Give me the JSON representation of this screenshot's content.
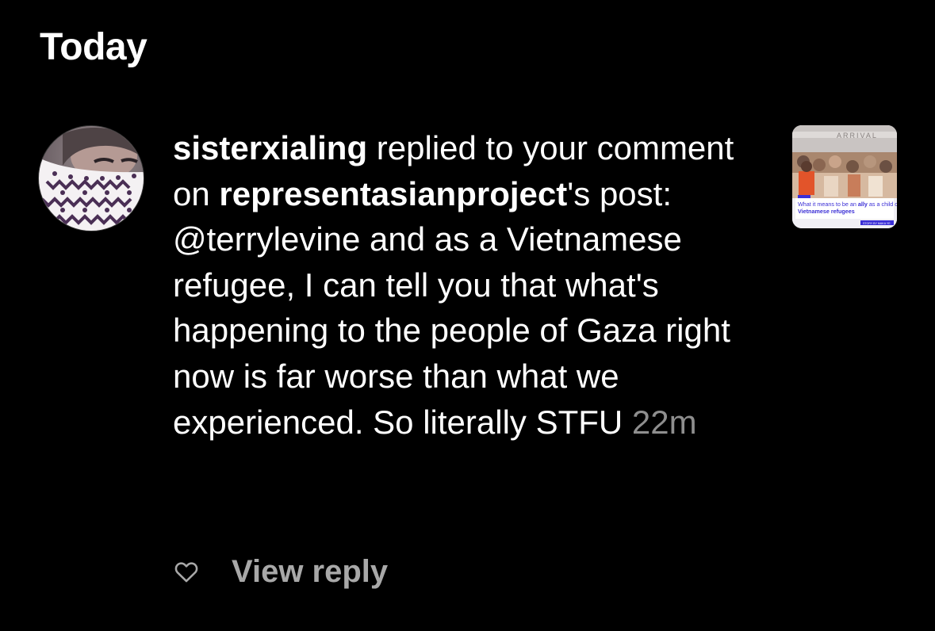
{
  "section": {
    "title": "Today"
  },
  "notification": {
    "username": "sisterxialing",
    "action_text": " replied to your comment on ",
    "post_owner": "representasianproject",
    "post_suffix": "'s post:",
    "comment": " @terrylevine and as a Vietnamese refugee, I can tell you that what's happening to the people of Gaza right now is far worse than what we experienced. So literally STFU ",
    "time": "22m",
    "avatar": {
      "icon": "keffiyeh-profile-photo",
      "description_colors": [
        "#6f6468",
        "#ffffff",
        "#5a3c5e"
      ]
    },
    "thumbnail": {
      "icon": "post-preview-thumbnail",
      "banner_text": "ARRIVAL",
      "caption_prefix": "What it means to be an ",
      "caption_highlight": "ally",
      "caption_mid": " as a child of ",
      "caption_bold": "Vietnamese refugees",
      "byline": "STORY BY MAKA YE"
    }
  },
  "actions": {
    "like_icon": "heart-outline-icon",
    "view_reply_label": "View reply"
  },
  "colors": {
    "background": "#000000",
    "text": "#ffffff",
    "muted": "#8e8e8e",
    "action": "#a8a8a8",
    "thumb_accent": "#3b2fd6"
  }
}
